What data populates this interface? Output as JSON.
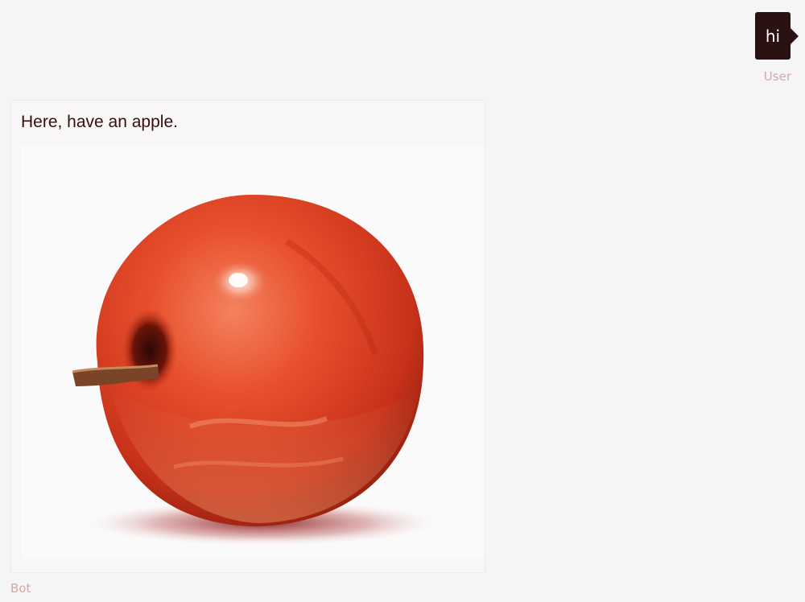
{
  "user_message": {
    "text": "hi",
    "sender": "User"
  },
  "bot_message": {
    "text": "Here, have an apple.",
    "sender": "Bot",
    "image": "red-apple"
  },
  "colors": {
    "user_bubble": "#2b1212",
    "sender_label": "#d6a7a7",
    "bot_text": "#3b0d0d",
    "background": "#f5f5f5"
  }
}
